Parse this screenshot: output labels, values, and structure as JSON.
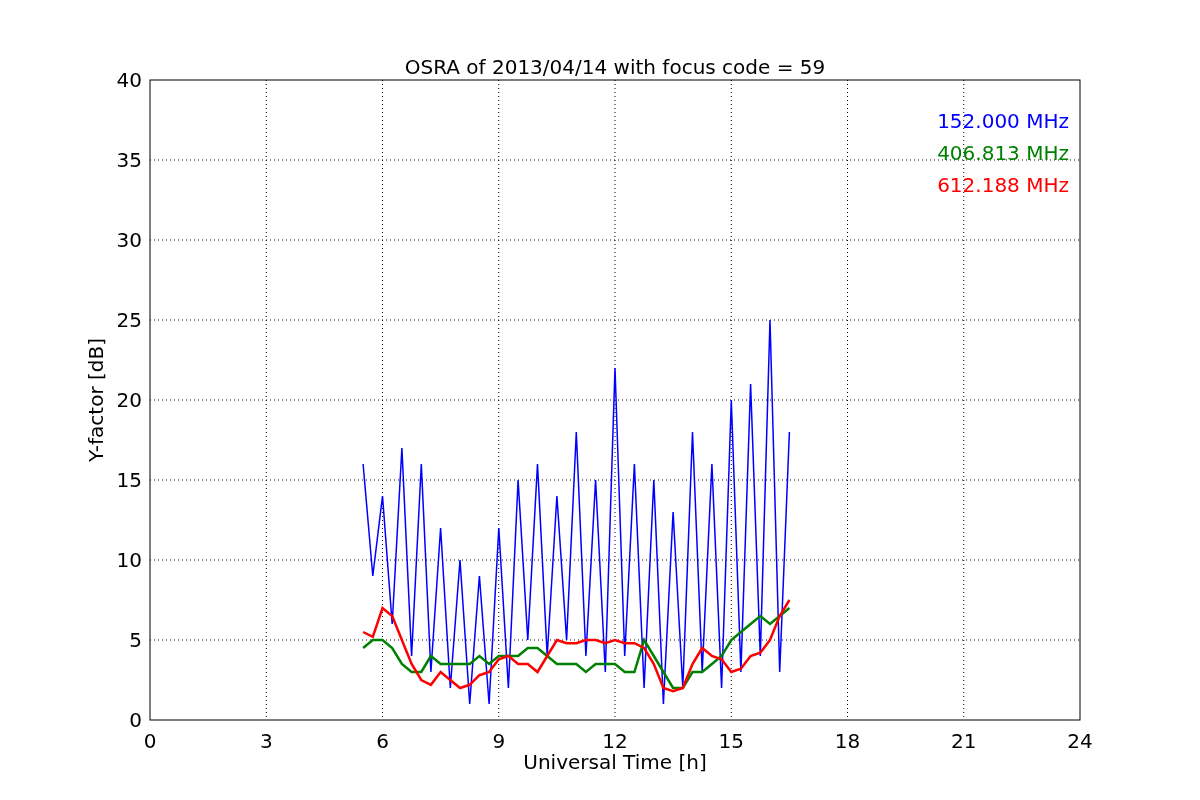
{
  "figure": {
    "chart_data": {
      "type": "line",
      "title": "OSRA of 2013/04/14 with focus code = 59",
      "xlabel": "Universal Time [h]",
      "ylabel": "Y-factor [dB]",
      "x": [
        5.5,
        5.75,
        6,
        6.25,
        6.5,
        6.75,
        7,
        7.25,
        7.5,
        7.75,
        8,
        8.25,
        8.5,
        8.75,
        9,
        9.25,
        9.5,
        9.75,
        10,
        10.25,
        10.5,
        10.75,
        11,
        11.25,
        11.5,
        11.75,
        12,
        12.25,
        12.5,
        12.75,
        13,
        13.25,
        13.5,
        13.75,
        14,
        14.25,
        14.5,
        14.75,
        15,
        15.25,
        15.5,
        15.75,
        16,
        16.25,
        16.5
      ],
      "series": [
        {
          "name": "152.000 MHz",
          "color": "#0000ff",
          "values": [
            16,
            9,
            14,
            6,
            17,
            4,
            16,
            3,
            12,
            2,
            10,
            1,
            9,
            1,
            12,
            2,
            15,
            5,
            16,
            4,
            14,
            5,
            18,
            4,
            15,
            3,
            22,
            4,
            16,
            2,
            15,
            1,
            13,
            2,
            18,
            3,
            16,
            2,
            20,
            3,
            21,
            4,
            25,
            3,
            18
          ]
        },
        {
          "name": "406.813 MHz",
          "color": "#008000",
          "values": [
            4.5,
            5,
            5,
            4.5,
            3.5,
            3,
            3,
            4,
            3.5,
            3.5,
            3.5,
            3.5,
            4,
            3.5,
            4,
            4,
            4,
            4.5,
            4.5,
            4,
            3.5,
            3.5,
            3.5,
            3,
            3.5,
            3.5,
            3.5,
            3,
            3,
            5,
            4,
            3,
            2,
            2,
            3,
            3,
            3.5,
            4,
            5,
            5.5,
            6,
            6.5,
            6,
            6.5,
            7
          ]
        },
        {
          "name": "612.188 MHz",
          "color": "#ff0000",
          "values": [
            5.5,
            5.2,
            7,
            6.5,
            5,
            3.5,
            2.5,
            2.2,
            3,
            2.5,
            2,
            2.2,
            2.8,
            3,
            3.8,
            4,
            3.5,
            3.5,
            3,
            4,
            5,
            4.8,
            4.8,
            5,
            5,
            4.8,
            5,
            4.8,
            4.8,
            4.5,
            3.5,
            2,
            1.8,
            2,
            3.5,
            4.5,
            4,
            3.8,
            3,
            3.2,
            4,
            4.2,
            5,
            6.5,
            7.5
          ]
        }
      ],
      "grid": true,
      "xlim": [
        0,
        24
      ],
      "ylim": [
        0,
        40
      ],
      "xticks": [
        0,
        3,
        6,
        9,
        12,
        15,
        18,
        21,
        24
      ],
      "yticks": [
        0,
        5,
        10,
        15,
        20,
        25,
        30,
        35,
        40
      ]
    }
  }
}
